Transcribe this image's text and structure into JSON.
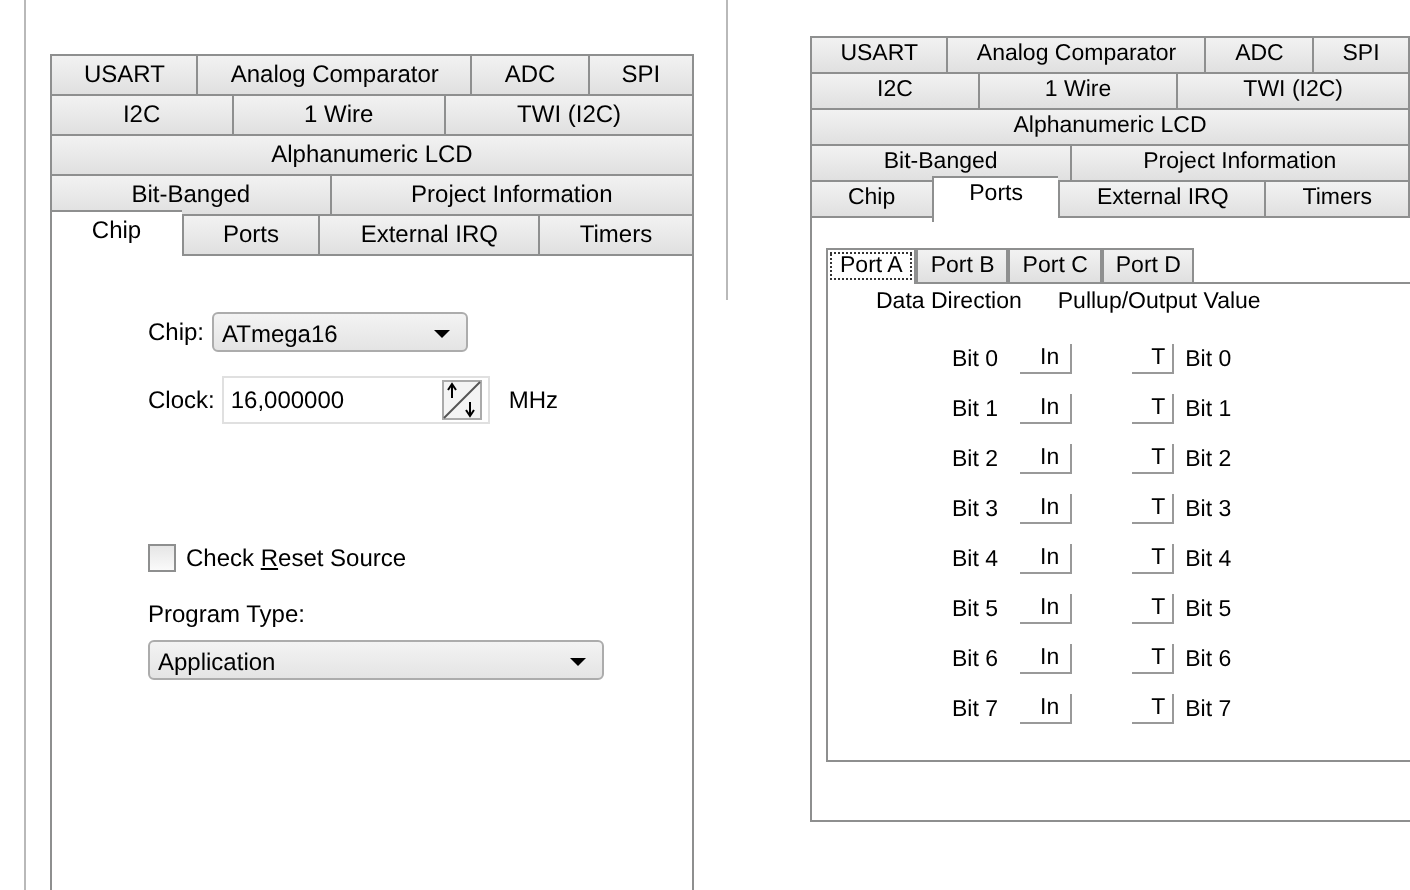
{
  "panels": [
    {
      "kind": "chip",
      "tab_rows": [
        [
          {
            "label": "USART",
            "selected": false
          },
          {
            "label": "Analog Comparator",
            "selected": false
          },
          {
            "label": "ADC",
            "selected": false
          },
          {
            "label": "SPI",
            "selected": false
          }
        ],
        [
          {
            "label": "I2C",
            "selected": false
          },
          {
            "label": "1 Wire",
            "selected": false
          },
          {
            "label": "TWI (I2C)",
            "selected": false
          }
        ],
        [
          {
            "label": "Alphanumeric LCD",
            "selected": false
          }
        ],
        [
          {
            "label": "Bit-Banged",
            "selected": false
          },
          {
            "label": "Project Information",
            "selected": false
          }
        ],
        [
          {
            "label": "Chip",
            "selected": true
          },
          {
            "label": "Ports",
            "selected": false
          },
          {
            "label": "External IRQ",
            "selected": false
          },
          {
            "label": "Timers",
            "selected": false
          }
        ]
      ],
      "chip": {
        "label": "Chip:",
        "value": "ATmega16"
      },
      "clock": {
        "label": "Clock:",
        "value": "16,000000",
        "unit": "MHz"
      },
      "check_reset_source": {
        "label": "Check **R**eset Source",
        "checked": false
      },
      "program_type": {
        "label": "Program Type:",
        "value": "Application"
      }
    },
    {
      "kind": "ports",
      "tab_rows": [
        [
          {
            "label": "USART",
            "selected": false
          },
          {
            "label": "Analog Comparator",
            "selected": false
          },
          {
            "label": "ADC",
            "selected": false
          },
          {
            "label": "SPI",
            "selected": false
          }
        ],
        [
          {
            "label": "I2C",
            "selected": false
          },
          {
            "label": "1 Wire",
            "selected": false
          },
          {
            "label": "TWI (I2C)",
            "selected": false
          }
        ],
        [
          {
            "label": "Alphanumeric LCD",
            "selected": false
          }
        ],
        [
          {
            "label": "Bit-Banged",
            "selected": false
          },
          {
            "label": "Project Information",
            "selected": false
          }
        ],
        [
          {
            "label": "Chip",
            "selected": false
          },
          {
            "label": "Ports",
            "selected": true
          },
          {
            "label": "External IRQ",
            "selected": false
          },
          {
            "label": "Timers",
            "selected": false
          }
        ]
      ],
      "port_tabs": [
        {
          "label": "Port A",
          "selected": true
        },
        {
          "label": "Port B",
          "selected": false
        },
        {
          "label": "Port C",
          "selected": false
        },
        {
          "label": "Port D",
          "selected": false
        }
      ],
      "headers": [
        "Data Direction",
        "Pullup/Output Value"
      ],
      "bits": [
        {
          "label": "Bit 0",
          "direction": "In",
          "value": "T",
          "value_label": "Bit 0"
        },
        {
          "label": "Bit 1",
          "direction": "In",
          "value": "T",
          "value_label": "Bit 1"
        },
        {
          "label": "Bit 2",
          "direction": "In",
          "value": "T",
          "value_label": "Bit 2"
        },
        {
          "label": "Bit 3",
          "direction": "In",
          "value": "T",
          "value_label": "Bit 3"
        },
        {
          "label": "Bit 4",
          "direction": "In",
          "value": "T",
          "value_label": "Bit 4"
        },
        {
          "label": "Bit 5",
          "direction": "In",
          "value": "T",
          "value_label": "Bit 5"
        },
        {
          "label": "Bit 6",
          "direction": "In",
          "value": "T",
          "value_label": "Bit 6"
        },
        {
          "label": "Bit 7",
          "direction": "In",
          "value": "T",
          "value_label": "Bit 7"
        }
      ]
    }
  ]
}
